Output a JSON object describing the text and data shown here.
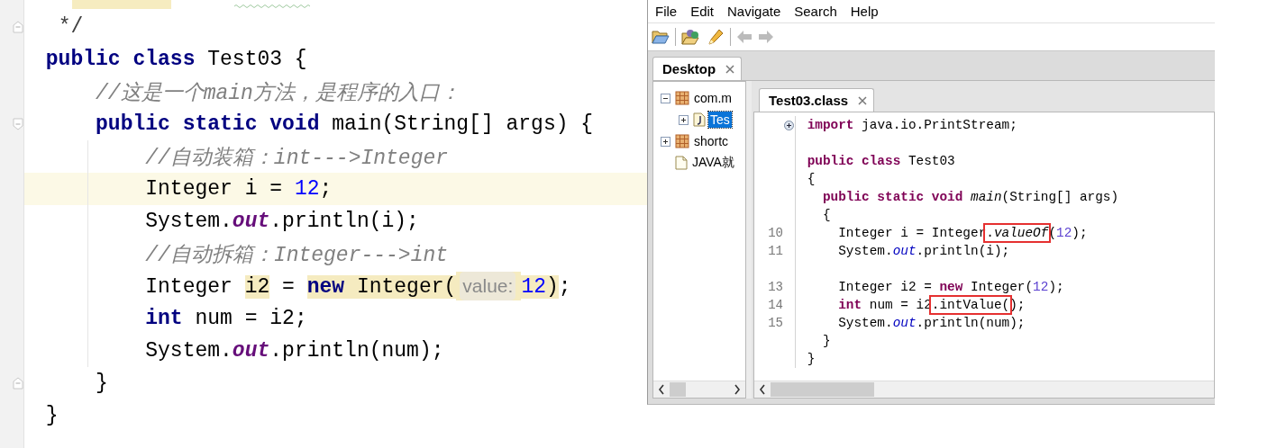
{
  "editor": {
    "lines": [
      {
        "fold_marker": {
          "kind": "end"
        },
        "tokens": [
          {
            "text": " */",
            "kind": "doc"
          }
        ]
      },
      {
        "tokens": [
          {
            "text": "public class",
            "kind": "keyword"
          },
          {
            "text": " Test03 {",
            "kind": "plain"
          }
        ]
      },
      {
        "tokens": [
          {
            "text": "    //这是一个main方法，是程序的入口：",
            "kind": "comment"
          }
        ]
      },
      {
        "fold_marker": {
          "kind": "start"
        },
        "tokens": [
          {
            "text": "    public static void",
            "kind": "keyword"
          },
          {
            "text": " main(String[] args) {",
            "kind": "plain"
          }
        ]
      },
      {
        "tokens": [
          {
            "text": "        //自动装箱：int--->Integer",
            "kind": "comment"
          }
        ]
      },
      {
        "highlighted": true,
        "tokens": [
          {
            "text": "        Integer i = ",
            "kind": "plain"
          },
          {
            "text": "12",
            "kind": "number"
          },
          {
            "text": ";",
            "kind": "plain"
          }
        ]
      },
      {
        "tokens": [
          {
            "text": "        System.",
            "kind": "plain"
          },
          {
            "text": "out",
            "kind": "field"
          },
          {
            "text": ".println(i);",
            "kind": "plain"
          }
        ]
      },
      {
        "tokens": [
          {
            "text": "        //自动拆箱：Integer--->int",
            "kind": "comment"
          }
        ]
      },
      {
        "tokens": [
          {
            "text": "        Integer ",
            "kind": "plain"
          },
          {
            "text": "i2",
            "kind": "plain",
            "highlight": true
          },
          {
            "text": " = ",
            "kind": "plain"
          },
          {
            "text": "new",
            "kind": "keyword",
            "highlight": true
          },
          {
            "text": " Integer(",
            "kind": "plain",
            "highlight": true
          },
          {
            "text": "value:",
            "kind": "hint",
            "highlight": true
          },
          {
            "text": "12",
            "kind": "number",
            "highlight": true
          },
          {
            "text": ")",
            "kind": "plain",
            "highlight": true
          },
          {
            "text": ";",
            "kind": "plain"
          }
        ]
      },
      {
        "tokens": [
          {
            "text": "        int",
            "kind": "keyword"
          },
          {
            "text": " num = i2;",
            "kind": "plain"
          }
        ]
      },
      {
        "tokens": [
          {
            "text": "        System.",
            "kind": "plain"
          },
          {
            "text": "out",
            "kind": "field"
          },
          {
            "text": ".println(num);",
            "kind": "plain"
          }
        ]
      },
      {
        "fold_marker": {
          "kind": "end"
        },
        "tokens": [
          {
            "text": "    }",
            "kind": "plain"
          }
        ]
      },
      {
        "tokens": [
          {
            "text": "}",
            "kind": "plain"
          }
        ]
      }
    ]
  },
  "decompiler": {
    "menu": [
      {
        "label": "File"
      },
      {
        "label": "Edit"
      },
      {
        "label": "Navigate"
      },
      {
        "label": "Search"
      },
      {
        "label": "Help"
      }
    ],
    "toolbar": [
      {
        "kind": "open",
        "disabled": false
      },
      {
        "kind": "separator"
      },
      {
        "kind": "open-type",
        "disabled": false
      },
      {
        "kind": "pencil",
        "disabled": false
      },
      {
        "kind": "separator"
      },
      {
        "kind": "back",
        "disabled": true
      },
      {
        "kind": "forward",
        "disabled": true
      }
    ],
    "tabs": [
      {
        "label": "Desktop",
        "selected": true
      }
    ],
    "tree": [
      {
        "label": "com.m",
        "kind": "package",
        "expanded": true,
        "selected": false,
        "children": [
          {
            "label": "Tes",
            "kind": "class",
            "expanded": false,
            "selected": true
          }
        ]
      },
      {
        "label": "shortc",
        "kind": "package",
        "expanded": false,
        "selected": false
      },
      {
        "label": "JAVA就",
        "kind": "file",
        "selected": false
      }
    ],
    "editor_tabs": [
      {
        "label": "Test03.class",
        "selected": true
      }
    ],
    "code": [
      {
        "kind": "code",
        "fold_marker": {
          "kind": "collapsed"
        },
        "tokens": [
          {
            "text": "import",
            "kind": "keyword"
          },
          {
            "text": " java.io.PrintStream;",
            "kind": "plain"
          }
        ]
      },
      {
        "kind": "blank"
      },
      {
        "kind": "code",
        "tokens": [
          {
            "text": "public class",
            "kind": "keyword"
          },
          {
            "text": " Test03",
            "kind": "plain"
          }
        ]
      },
      {
        "kind": "code",
        "tokens": [
          {
            "text": "{",
            "kind": "plain"
          }
        ]
      },
      {
        "kind": "code",
        "tokens": [
          {
            "text": "  public static void",
            "kind": "keyword"
          },
          {
            "text": " main",
            "kind": "method"
          },
          {
            "text": "(String[] args)",
            "kind": "plain"
          }
        ]
      },
      {
        "kind": "code",
        "tokens": [
          {
            "text": "  {",
            "kind": "plain"
          }
        ]
      },
      {
        "kind": "code",
        "number": "10",
        "tokens": [
          {
            "text": "    Integer i = Integer",
            "kind": "plain"
          },
          {
            "text": ".",
            "kind": "plain",
            "boxed": true
          },
          {
            "text": "valueOf",
            "kind": "method",
            "boxed": true
          },
          {
            "text": "(",
            "kind": "plain"
          },
          {
            "text": "12",
            "kind": "number"
          },
          {
            "text": ");",
            "kind": "plain"
          }
        ]
      },
      {
        "kind": "code",
        "number": "11",
        "tokens": [
          {
            "text": "    System.",
            "kind": "plain"
          },
          {
            "text": "out",
            "kind": "field"
          },
          {
            "text": ".println(i);",
            "kind": "plain"
          }
        ]
      },
      {
        "kind": "blank"
      },
      {
        "kind": "code",
        "number": "13",
        "tokens": [
          {
            "text": "    Integer i2 = ",
            "kind": "plain"
          },
          {
            "text": "new",
            "kind": "keyword"
          },
          {
            "text": " Integer(",
            "kind": "plain"
          },
          {
            "text": "12",
            "kind": "number"
          },
          {
            "text": ");",
            "kind": "plain"
          }
        ]
      },
      {
        "kind": "code",
        "number": "14",
        "tokens": [
          {
            "text": "    int",
            "kind": "keyword"
          },
          {
            "text": " num = i2",
            "kind": "plain"
          },
          {
            "text": ".intValue(",
            "kind": "plain",
            "boxed": true
          },
          {
            "text": ");",
            "kind": "plain"
          }
        ]
      },
      {
        "kind": "code",
        "number": "15",
        "tokens": [
          {
            "text": "    System.",
            "kind": "plain"
          },
          {
            "text": "out",
            "kind": "field"
          },
          {
            "text": ".println(num);",
            "kind": "plain"
          }
        ]
      },
      {
        "kind": "code",
        "tokens": [
          {
            "text": "  }",
            "kind": "plain"
          }
        ]
      },
      {
        "kind": "code",
        "tokens": [
          {
            "text": "}",
            "kind": "plain"
          }
        ]
      }
    ]
  }
}
